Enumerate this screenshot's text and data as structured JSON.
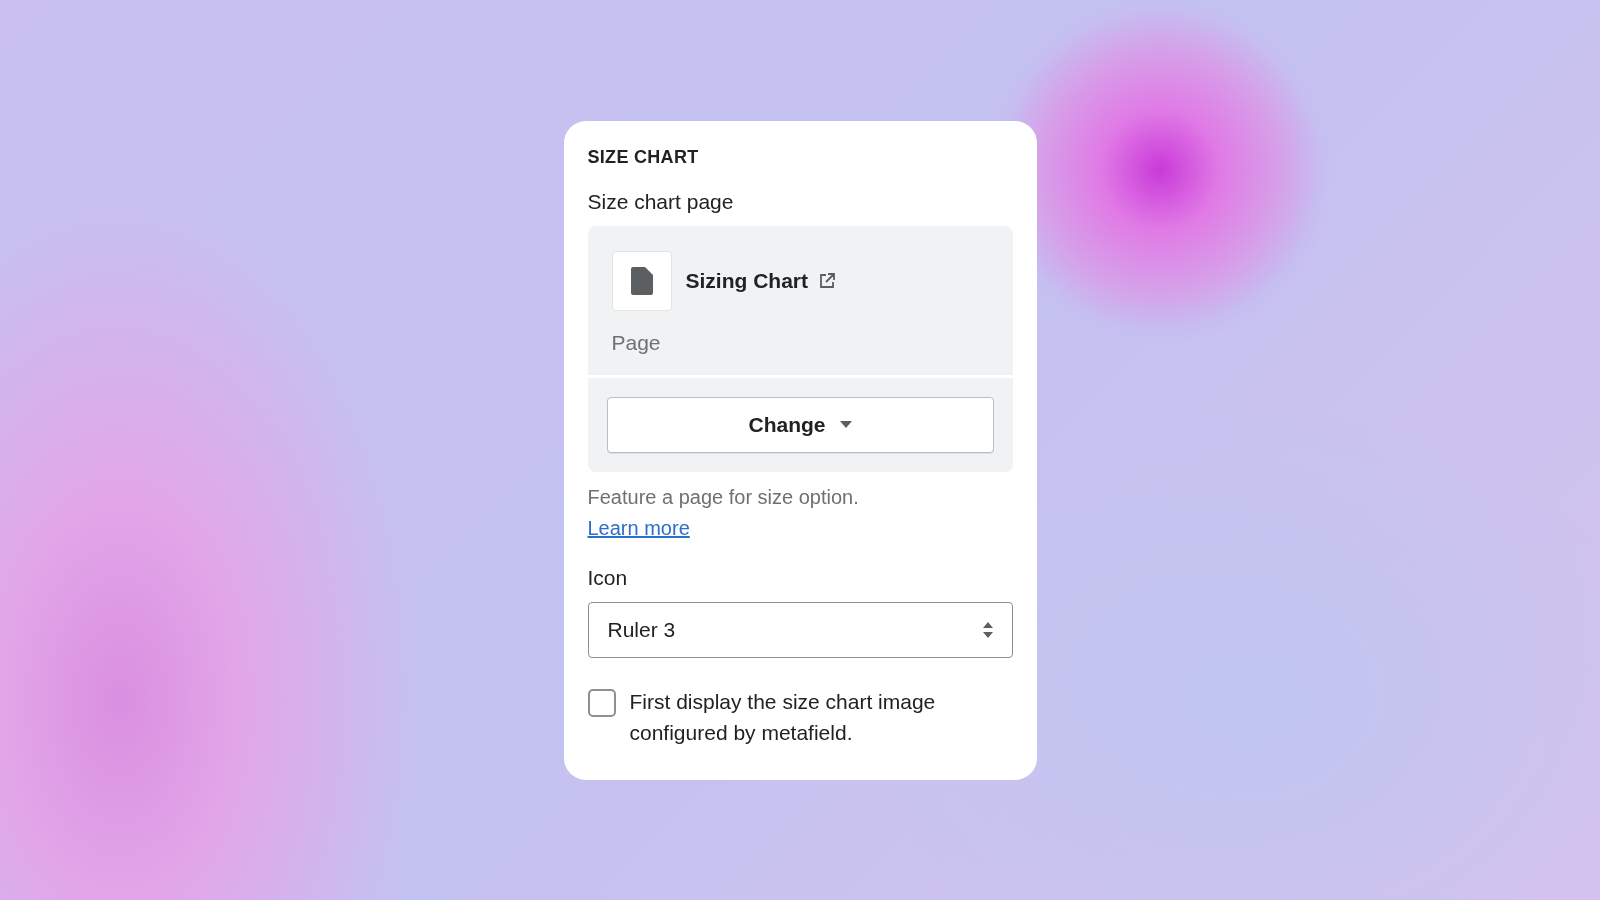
{
  "section": {
    "title": "SIZE CHART"
  },
  "page_picker": {
    "label": "Size chart page",
    "page_title": "Sizing Chart",
    "page_type": "Page",
    "button": "Change"
  },
  "help_text": "Feature a page for size option.",
  "help_link": "Learn more",
  "icon_select": {
    "label": "Icon",
    "value": "Ruler 3"
  },
  "metafield_option": {
    "label": "First display the size chart image configured by metafield.",
    "checked": false
  }
}
